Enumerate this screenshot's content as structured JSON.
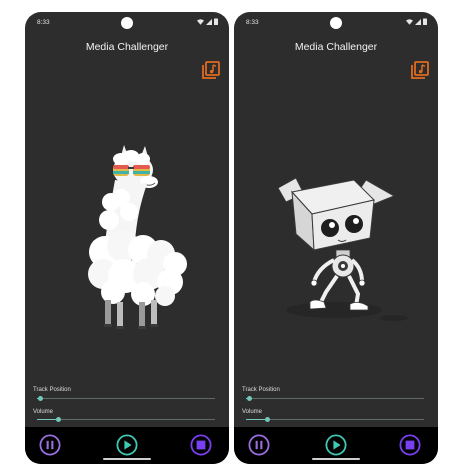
{
  "screens": [
    {
      "status_time": "8:33",
      "title": "Media Challenger",
      "artwork_icon": "llama-with-sunglasses-icon",
      "track_position_label": "Track Position",
      "volume_label": "Volume",
      "track_position_fraction": 0.02,
      "volume_fraction": 0.12
    },
    {
      "status_time": "8:33",
      "title": "Media Challenger",
      "artwork_icon": "box-head-robot-icon",
      "track_position_label": "Track Position",
      "volume_label": "Volume",
      "track_position_fraction": 0.02,
      "volume_fraction": 0.12
    }
  ],
  "colors": {
    "background": "#2d2d2d",
    "accent_orange": "#e06b1f",
    "slider_teal": "#73c7b9",
    "pause_purple": "#9b6fe0",
    "play_teal": "#3fc8b4",
    "stop_purple": "#7b3ff2"
  }
}
